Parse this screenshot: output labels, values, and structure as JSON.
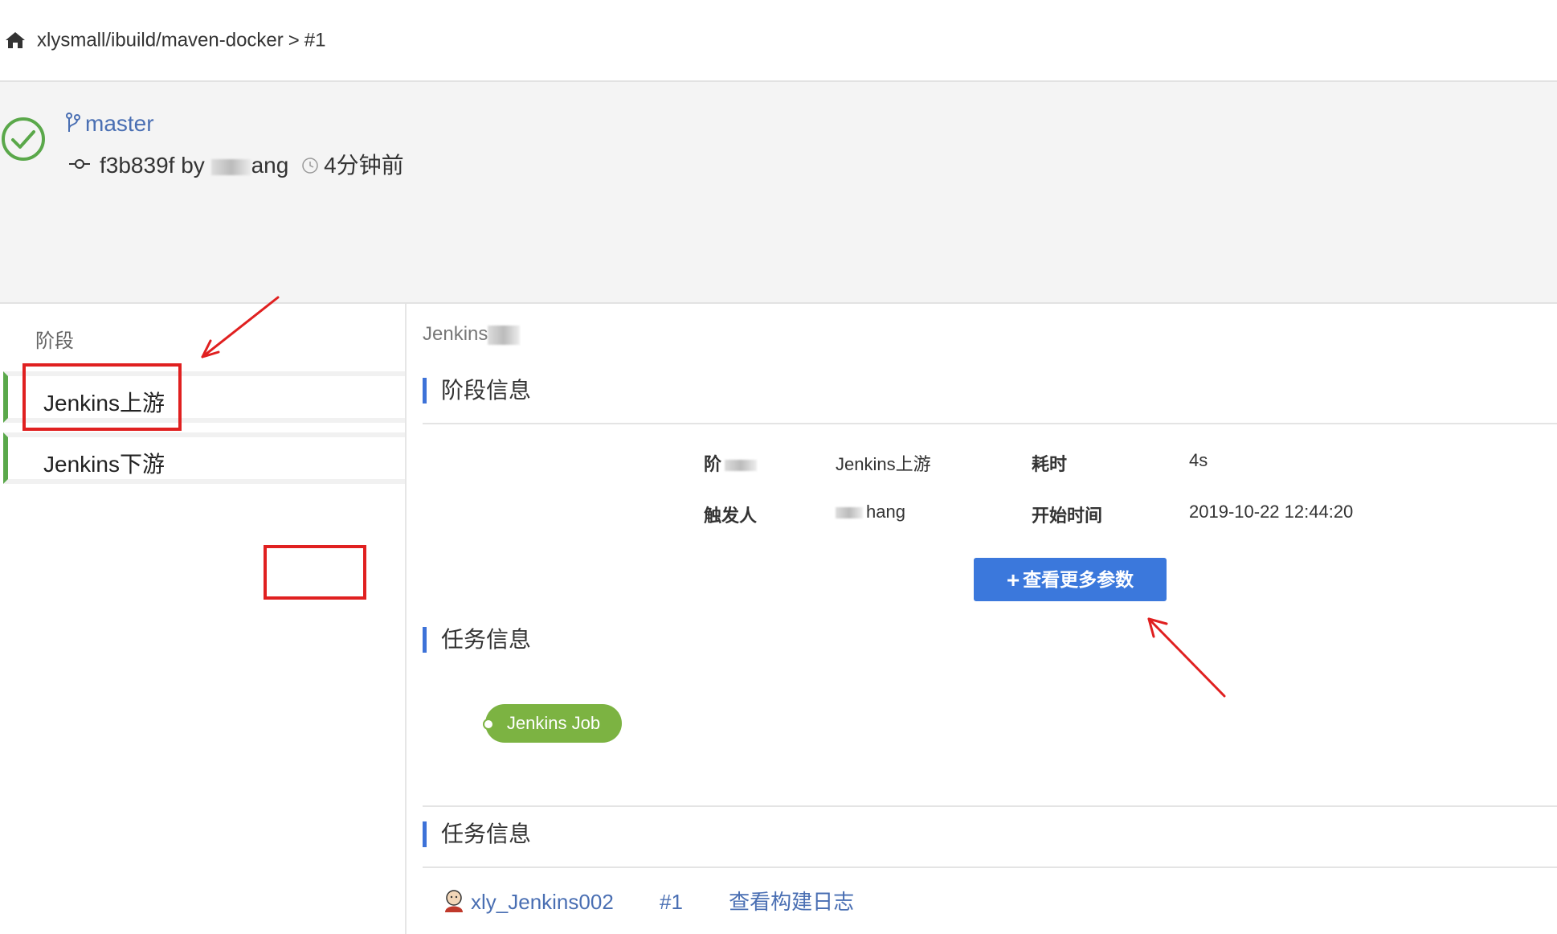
{
  "breadcrumb": {
    "path": "xlysmall/ibuild/maven-docker",
    "separator": ">",
    "build": "#1"
  },
  "header": {
    "branch": "master",
    "commit": "f3b839f",
    "by_label": "by",
    "author_suffix": "ang",
    "time_ago": "4分钟前",
    "status": "success"
  },
  "sidebar": {
    "title": "阶段",
    "stages": [
      {
        "label": "Jenkins上游"
      },
      {
        "label": "Jenkins下游"
      }
    ]
  },
  "main": {
    "crumb": "Jenkins",
    "stage_info_title": "阶段信息",
    "info": {
      "stage_key": "阶",
      "stage_value": "Jenkins上游",
      "duration_key": "耗时",
      "duration_value": "4s",
      "trigger_key": "触发人",
      "trigger_value": "hang",
      "start_key": "开始时间",
      "start_value": "2019-10-22 12:44:20"
    },
    "more_params_button": "查看更多参数",
    "task_info_title_1": "任务信息",
    "job_pill": "Jenkins Job",
    "task_info_title_2": "任务信息",
    "job_link": "xly_Jenkins002",
    "job_build": "#1",
    "view_log": "查看构建日志"
  },
  "colors": {
    "accent": "#3b78dc",
    "success": "#5aa84a",
    "link": "#4a6fb3",
    "annotation": "#e02020"
  }
}
